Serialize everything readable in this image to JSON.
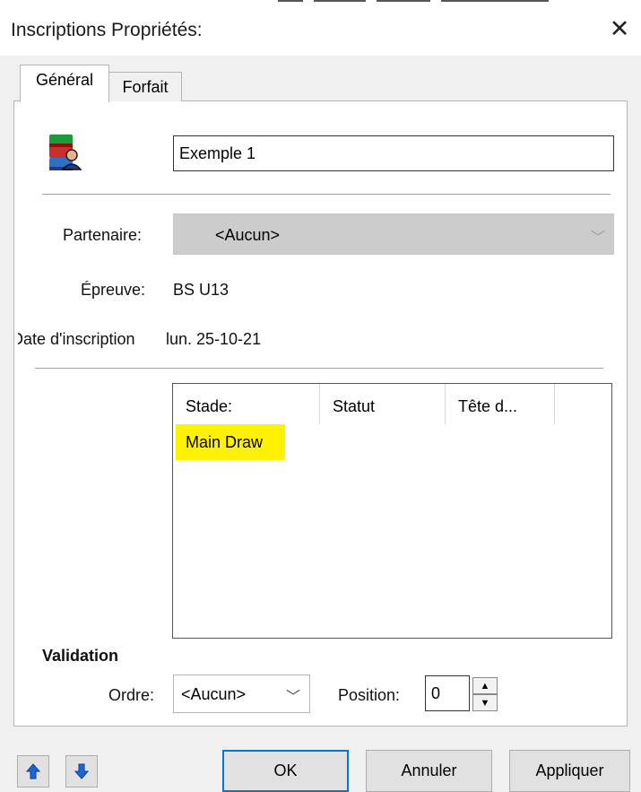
{
  "window": {
    "title": "Inscriptions Propriétés:",
    "close_glyph": "✕"
  },
  "tabs": [
    {
      "label": "Général",
      "active": true
    },
    {
      "label": "Forfait",
      "active": false
    }
  ],
  "general": {
    "name_value": "Exemple 1",
    "partner_label": "Partenaire:",
    "partner_value": "<Aucun>",
    "event_label": "Épreuve:",
    "event_value": "BS U13",
    "date_label": "Date d'inscription",
    "date_value": "lun. 25-10-21"
  },
  "stage_list": {
    "columns": [
      "Stade:",
      "Statut",
      "Tête d..."
    ],
    "rows": [
      {
        "stage": "Main Draw",
        "highlight": "#fff200"
      }
    ]
  },
  "validation": {
    "heading": "Validation",
    "order_label": "Ordre:",
    "order_value": "<Aucun>",
    "position_label": "Position:",
    "position_value": "0"
  },
  "footer": {
    "up_icon": "arrow-up-icon",
    "down_icon": "arrow-down-icon",
    "ok_label": "OK",
    "cancel_label": "Annuler",
    "apply_label": "Appliquer"
  },
  "colors": {
    "accent": "#0078d7",
    "highlight": "#fff200",
    "dialog_bg": "#f0f0f0"
  }
}
